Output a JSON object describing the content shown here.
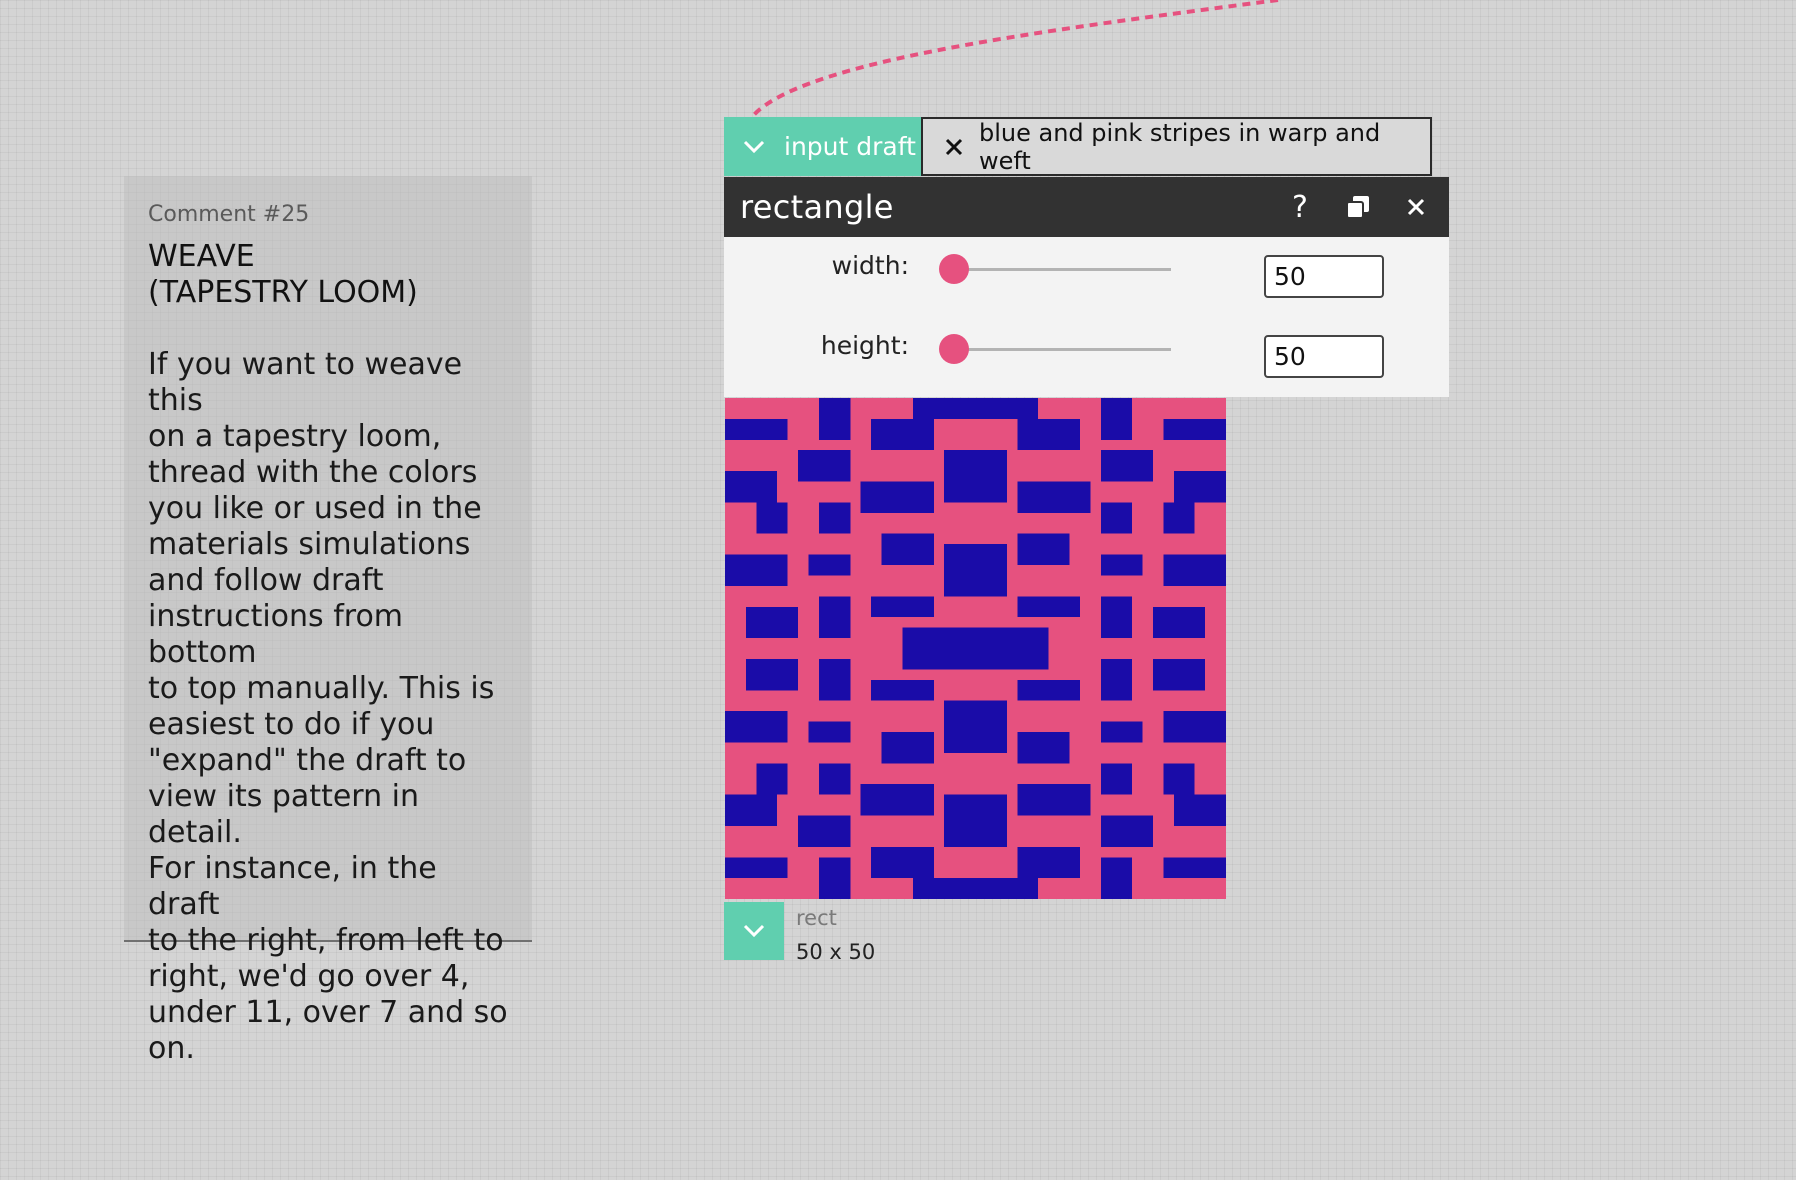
{
  "comment": {
    "number_label": "Comment #25",
    "heading": "WEAVE\n(TAPESTRY LOOM)",
    "body": "If you want to weave this\non a tapestry loom,\nthread with the colors\nyou like or used in the\nmaterials simulations\nand follow draft\ninstructions from bottom\nto top manually. This is\neasiest to do if you\n\"expand\" the draft to\nview its pattern in detail.\nFor instance, in the draft\nto the right, from left to\nright, we'd go over 4,\nunder 11, over 7 and so\non."
  },
  "input_tab": {
    "label": "input draft",
    "icon": "chevron-down-icon",
    "connected_draft": "blue and pink stripes in warp and weft",
    "remove_icon": "close-icon"
  },
  "operation": {
    "title": "rectangle",
    "help_label": "?",
    "duplicate_icon": "duplicate-icon",
    "delete_icon": "close-icon",
    "params": [
      {
        "label": "width:",
        "value": "50",
        "slider_fraction": 0.01
      },
      {
        "label": "height:",
        "value": "50",
        "slider_fraction": 0.01
      }
    ]
  },
  "output": {
    "name": "rect",
    "size": "50 x 50",
    "icon": "chevron-down-icon"
  },
  "colors": {
    "accent": "#60cfaf",
    "header": "#323232",
    "pink": "#e6517f",
    "blue": "#1a0ca8",
    "wire": "#e6517f"
  }
}
